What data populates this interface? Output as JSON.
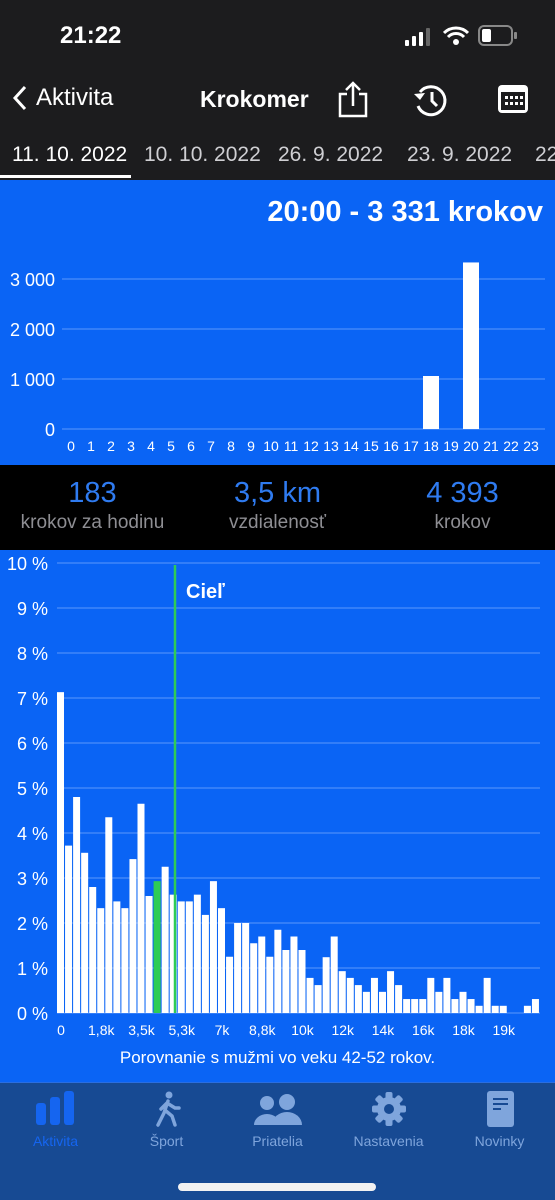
{
  "status_bar": {
    "time": "21:22",
    "icons": [
      "cellular-signal-icon",
      "wifi-icon",
      "battery-icon"
    ]
  },
  "nav": {
    "back_label": "Aktivita",
    "title": "Krokomer",
    "icons": [
      "share-icon",
      "history-icon",
      "calendar-icon"
    ]
  },
  "date_tabs": [
    {
      "label": "11. 10. 2022",
      "active": true
    },
    {
      "label": "10. 10. 2022"
    },
    {
      "label": "26. 9. 2022"
    },
    {
      "label": "23. 9. 2022"
    },
    {
      "label": "22"
    }
  ],
  "headline": "20:00 - 3 331 krokov",
  "stats": [
    {
      "value": "183",
      "label": "krokov za hodinu"
    },
    {
      "value": "3,5 km",
      "label": "vzdialenosť"
    },
    {
      "value": "4 393",
      "label": "krokov"
    }
  ],
  "caption": "Porovnanie s mužmi vo veku 42-52 rokov.",
  "goal_label": "Cieľ",
  "colors": {
    "background": "#0a64f5",
    "bar": "#ffffff",
    "highlight": "#2ecc55",
    "goal": "#2ecc55",
    "tabbar": "#174a93",
    "stat_value": "#2f7bf0"
  },
  "chart_data": [
    {
      "type": "bar",
      "x": [
        0,
        1,
        2,
        3,
        4,
        5,
        6,
        7,
        8,
        9,
        10,
        11,
        12,
        13,
        14,
        15,
        16,
        17,
        18,
        19,
        20,
        21,
        22,
        23
      ],
      "values": [
        0,
        0,
        0,
        0,
        0,
        0,
        0,
        0,
        0,
        0,
        0,
        0,
        0,
        0,
        0,
        0,
        0,
        0,
        1060,
        0,
        3331,
        0,
        0,
        0
      ],
      "ylim": [
        0,
        3300
      ],
      "yticks": [
        "0",
        "1 000",
        "2 000",
        "3 000"
      ],
      "ytick_values": [
        0,
        1000,
        2000,
        3000
      ],
      "grid": true
    },
    {
      "type": "bar",
      "values": [
        7.13,
        3.72,
        4.8,
        3.56,
        2.8,
        2.33,
        4.35,
        2.48,
        2.33,
        3.42,
        4.65,
        2.6,
        2.93,
        3.25,
        2.63,
        2.48,
        2.48,
        2.63,
        2.18,
        2.93,
        2.33,
        1.25,
        2.0,
        2.0,
        1.55,
        1.7,
        1.25,
        1.85,
        1.4,
        1.7,
        1.4,
        0.78,
        0.62,
        1.24,
        1.7,
        0.93,
        0.78,
        0.62,
        0.47,
        0.78,
        0.47,
        0.93,
        0.62,
        0.31,
        0.31,
        0.31,
        0.78,
        0.47,
        0.78,
        0.31,
        0.47,
        0.31,
        0.16,
        0.78,
        0.16,
        0.16,
        0,
        0,
        0.16,
        0.31
      ],
      "highlight_index": 12,
      "ylim": [
        0,
        10
      ],
      "yticks": [
        "0 %",
        "1 %",
        "2 %",
        "3 %",
        "4 %",
        "5 %",
        "6 %",
        "7 %",
        "8 %",
        "9 %",
        "10 %"
      ],
      "xticks": [
        "0",
        "1,8k",
        "3,5k",
        "5,3k",
        "7k",
        "8,8k",
        "10k",
        "12k",
        "14k",
        "16k",
        "18k",
        "19k"
      ],
      "grid": true
    }
  ],
  "tabbar": [
    {
      "label": "Aktivita",
      "icon": "bar-chart-icon",
      "active": true
    },
    {
      "label": "Šport",
      "icon": "walking-icon"
    },
    {
      "label": "Priatelia",
      "icon": "friends-icon"
    },
    {
      "label": "Nastavenia",
      "icon": "gear-icon"
    },
    {
      "label": "Novinky",
      "icon": "news-icon"
    }
  ]
}
